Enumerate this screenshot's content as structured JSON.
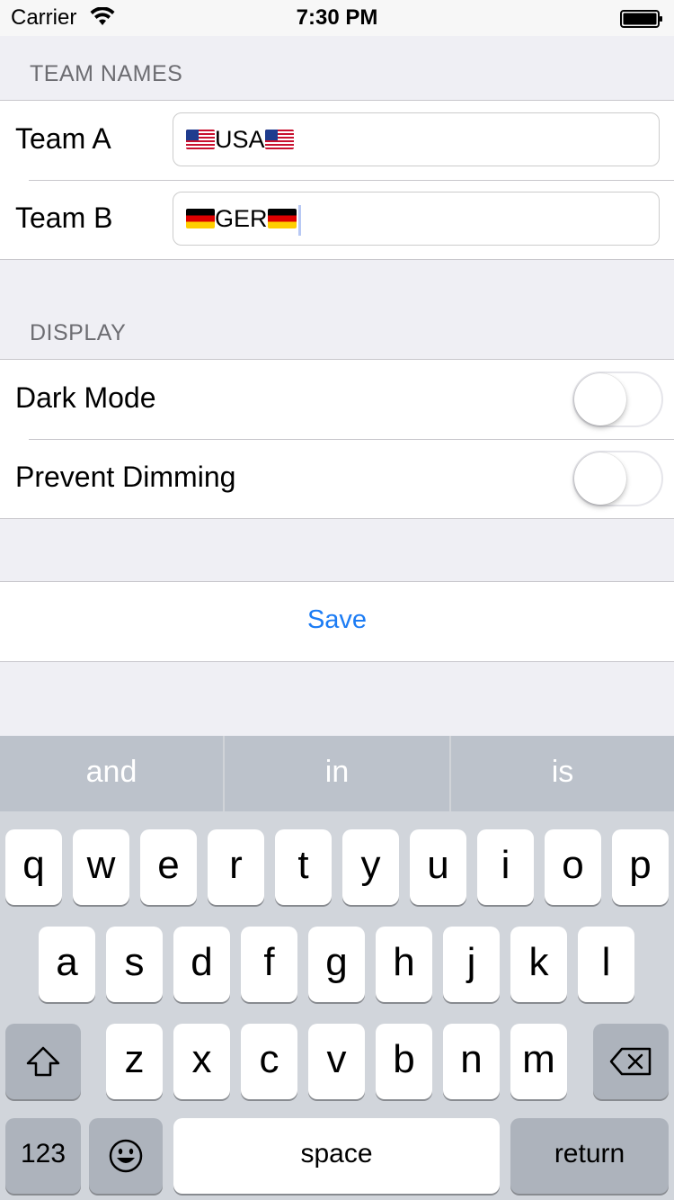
{
  "status_bar": {
    "carrier": "Carrier",
    "time": "7:30 PM"
  },
  "team_names": {
    "header": "TEAM NAMES",
    "team_a": {
      "label": "Team A",
      "value": "USA"
    },
    "team_b": {
      "label": "Team B",
      "value": "GER"
    }
  },
  "display": {
    "header": "DISPLAY",
    "dark_mode": {
      "label": "Dark Mode",
      "on": false
    },
    "prevent_dimming": {
      "label": "Prevent Dimming",
      "on": false
    }
  },
  "save": {
    "label": "Save",
    "color": "#1c7cf4"
  },
  "keyboard": {
    "suggestions": [
      "and",
      "in",
      "is"
    ],
    "row1": [
      "q",
      "w",
      "e",
      "r",
      "t",
      "y",
      "u",
      "i",
      "o",
      "p"
    ],
    "row2": [
      "a",
      "s",
      "d",
      "f",
      "g",
      "h",
      "j",
      "k",
      "l"
    ],
    "row3": [
      "z",
      "x",
      "c",
      "v",
      "b",
      "n",
      "m"
    ],
    "numbers_key": "123",
    "space_key": "space",
    "return_key": "return",
    "icons": {
      "shift": "shift-icon",
      "delete": "delete-icon",
      "emoji": "emoji-icon"
    }
  }
}
